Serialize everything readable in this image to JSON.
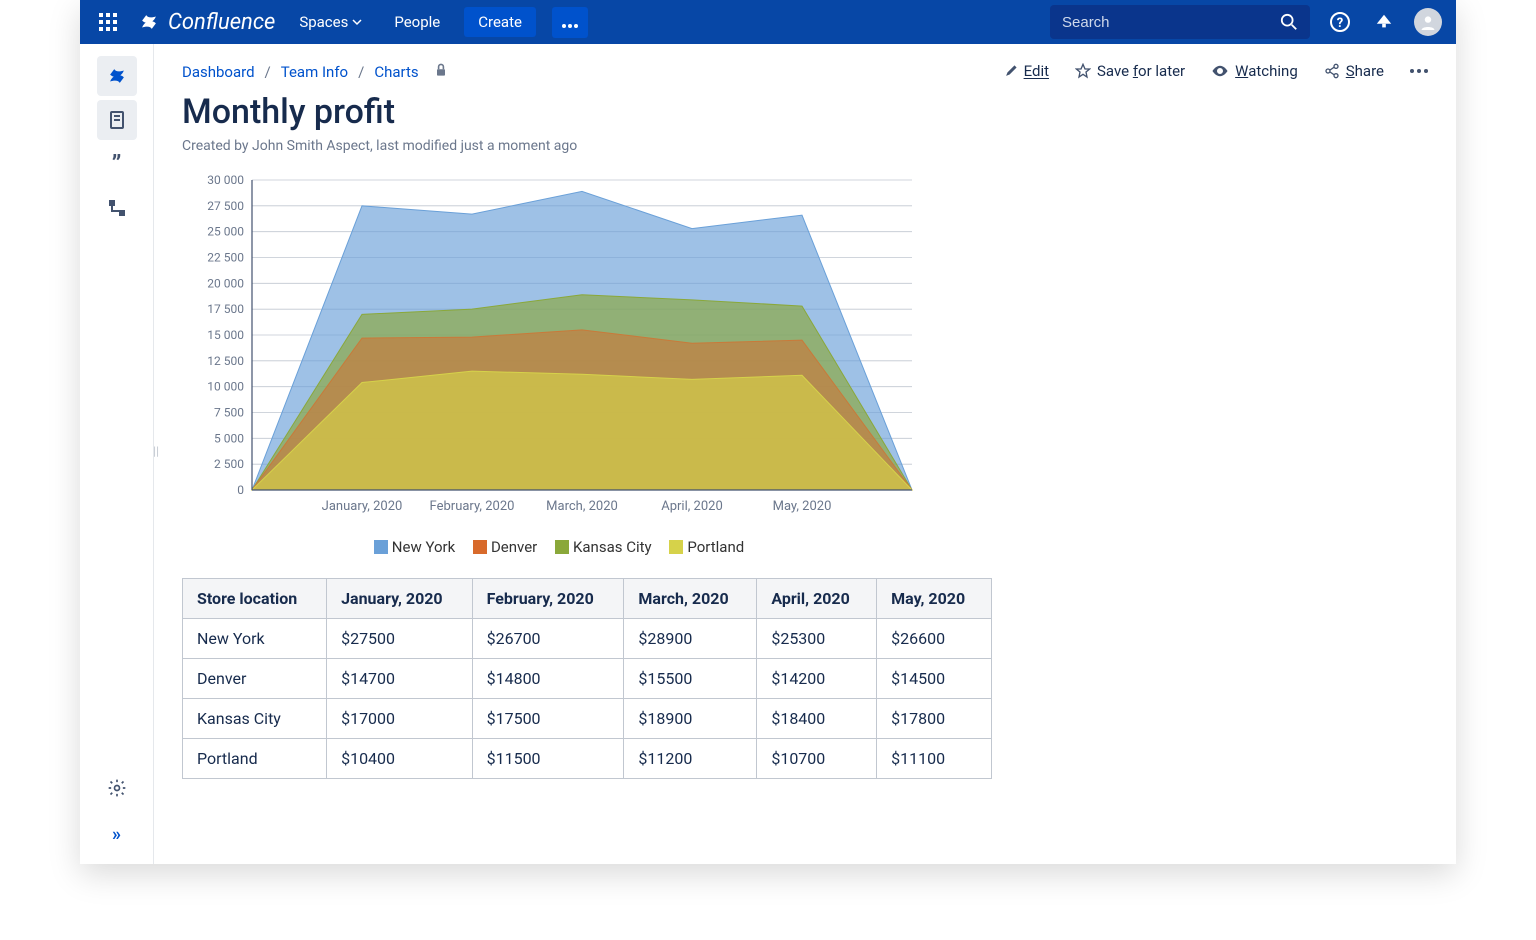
{
  "topbar": {
    "product": "Confluence",
    "spaces": "Spaces",
    "people": "People",
    "create": "Create",
    "search_placeholder": "Search"
  },
  "breadcrumbs": {
    "dashboard": "Dashboard",
    "team_info": "Team Info",
    "charts": "Charts"
  },
  "actions": {
    "edit": "Edit",
    "save": "Save for later",
    "watching": "Watching",
    "share": "Share"
  },
  "page": {
    "title": "Monthly profit",
    "byline": "Created by John Smith Aspect, last modified just a moment ago"
  },
  "legend": {
    "ny": "New York",
    "dv": "Denver",
    "kc": "Kansas City",
    "pt": "Portland"
  },
  "table_header": {
    "loc": "Store location",
    "m1": "January, 2020",
    "m2": "February, 2020",
    "m3": "March, 2020",
    "m4": "April, 2020",
    "m5": "May, 2020"
  },
  "table_rows": [
    {
      "loc": "New York",
      "m1": "$27500",
      "m2": "$26700",
      "m3": "$28900",
      "m4": "$25300",
      "m5": "$26600"
    },
    {
      "loc": "Denver",
      "m1": "$14700",
      "m2": "$14800",
      "m3": "$15500",
      "m4": "$14200",
      "m5": "$14500"
    },
    {
      "loc": "Kansas City",
      "m1": "$17000",
      "m2": "$17500",
      "m3": "$18900",
      "m4": "$18400",
      "m5": "$17800"
    },
    {
      "loc": "Portland",
      "m1": "$10400",
      "m2": "$11500",
      "m3": "$11200",
      "m4": "$10700",
      "m5": "$11100"
    }
  ],
  "chart_data": {
    "type": "area",
    "title": "",
    "xlabel": "",
    "ylabel": "",
    "ylim": [
      0,
      30000
    ],
    "yticks": [
      0,
      2500,
      5000,
      7500,
      10000,
      12500,
      15000,
      17500,
      20000,
      22500,
      25000,
      27500,
      30000
    ],
    "ytick_labels": [
      "0",
      "2 500",
      "5 000",
      "7 500",
      "10 000",
      "12 500",
      "15 000",
      "17 500",
      "20 000",
      "22 500",
      "25 000",
      "27 500",
      "30 000"
    ],
    "categories": [
      "January, 2020",
      "February, 2020",
      "March, 2020",
      "April, 2020",
      "May, 2020"
    ],
    "padded_x": [
      "",
      "January, 2020",
      "February, 2020",
      "March, 2020",
      "April, 2020",
      "May, 2020",
      ""
    ],
    "series": [
      {
        "name": "New York",
        "color": "#6aa0d8",
        "padded_values": [
          0,
          27500,
          26700,
          28900,
          25300,
          26600,
          0
        ]
      },
      {
        "name": "Kansas City",
        "color": "#8aa83a",
        "padded_values": [
          0,
          17000,
          17500,
          18900,
          18400,
          17800,
          0
        ]
      },
      {
        "name": "Denver",
        "color": "#c97a3a",
        "padded_values": [
          0,
          14700,
          14800,
          15500,
          14200,
          14500,
          0
        ]
      },
      {
        "name": "Portland",
        "color": "#d6d24a",
        "padded_values": [
          0,
          10400,
          11500,
          11200,
          10700,
          11100,
          0
        ]
      }
    ]
  },
  "colors": {
    "ny": "#6aa0d8",
    "dv": "#d86a2b",
    "kc": "#8aa83a",
    "pt": "#d6d24a"
  }
}
